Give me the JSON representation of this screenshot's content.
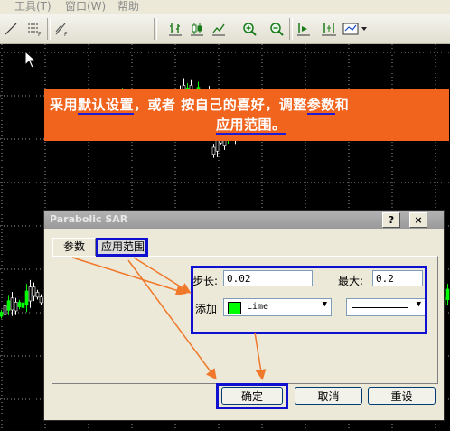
{
  "menu": {
    "tools": "工具(T)",
    "window": "窗口(W)",
    "help": "帮助"
  },
  "toolbar": {
    "icons": [
      "line-tool-icon",
      "period-list-icon",
      "draw-tools-icon",
      "bar-chart-icon",
      "candle-chart-icon",
      "line-chart-icon",
      "zoom-in-icon",
      "zoom-out-icon",
      "auto-scroll-icon",
      "chart-shift-icon",
      "templates-icon"
    ]
  },
  "banner": {
    "line1_a": "采用",
    "line1_b": "默认设置",
    "line1_c": "，或者 按自己的喜好，调整",
    "line1_d": "参数",
    "line1_e": "和",
    "line2": "应用范围。"
  },
  "dialog": {
    "title": "Parabolic SAR",
    "help_btn": "?",
    "close_btn": "×",
    "tab_params": "参数",
    "tab_range": "应用范围",
    "step_label": "步长:",
    "step_value": "0.02",
    "max_label": "最大:",
    "max_value": "0.2",
    "color_label": "添加",
    "color_value": "Lime",
    "ok": "确定",
    "cancel": "取消",
    "reset": "重设"
  },
  "colors": {
    "banner": "#f0641e",
    "highlight": "#1010d0",
    "lime": "#00ff00",
    "candle_up": "#00ff00",
    "candle_down": "#ffffff"
  }
}
